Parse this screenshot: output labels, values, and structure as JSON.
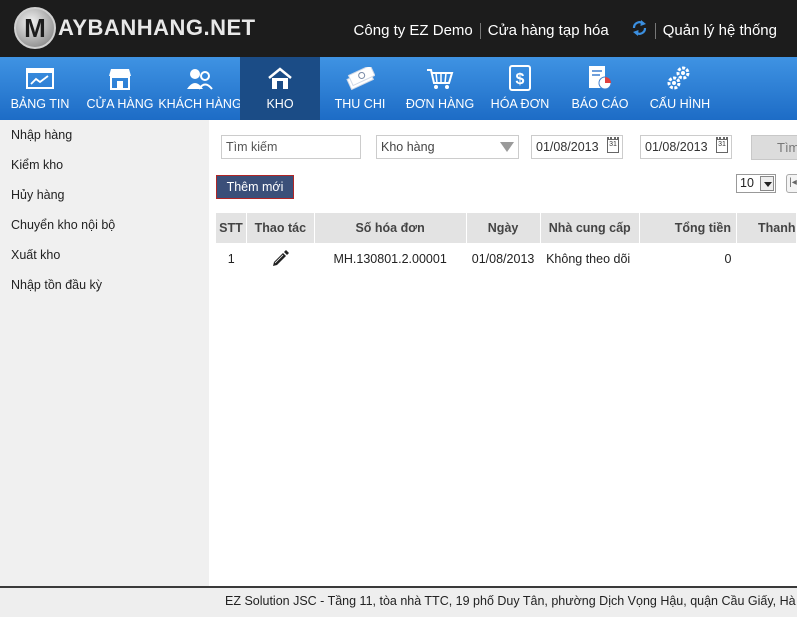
{
  "header": {
    "logo_letter": "M",
    "logo_text": "AYBANHANG.NET",
    "company": "Công ty EZ Demo",
    "store": "Cửa hàng tạp hóa",
    "admin": "Quản lý hệ thống"
  },
  "nav": {
    "items": [
      {
        "label": "BẢNG TIN",
        "icon": "dashboard-icon"
      },
      {
        "label": "CỬA HÀNG",
        "icon": "store-icon"
      },
      {
        "label": "KHÁCH HÀNG",
        "icon": "customers-icon"
      },
      {
        "label": "KHO",
        "icon": "warehouse-icon"
      },
      {
        "label": "THU CHI",
        "icon": "cash-icon"
      },
      {
        "label": "ĐƠN HÀNG",
        "icon": "cart-icon"
      },
      {
        "label": "HÓA ĐƠN",
        "icon": "invoice-icon"
      },
      {
        "label": "BÁO CÁO",
        "icon": "report-icon"
      },
      {
        "label": "CẤU HÌNH",
        "icon": "settings-icon"
      }
    ],
    "active_index": 3
  },
  "sidebar": {
    "items": [
      {
        "label": "Nhập hàng"
      },
      {
        "label": "Kiểm kho"
      },
      {
        "label": "Hủy hàng"
      },
      {
        "label": "Chuyển kho nội bộ"
      },
      {
        "label": "Xuất kho"
      },
      {
        "label": "Nhập tồn đầu kỳ"
      }
    ]
  },
  "filters": {
    "search_value": "Tìm kiếm",
    "warehouse_selected": "Kho hàng",
    "date_from": "01/08/2013",
    "date_to": "01/08/2013",
    "calendar_day": "31",
    "find_label": "Tìm"
  },
  "toolbar": {
    "add_label": "Thêm mới",
    "page_size": "10",
    "first_page": "|◂"
  },
  "table": {
    "headers": {
      "stt": "STT",
      "action": "Thao tác",
      "invoice": "Số hóa đơn",
      "date": "Ngày",
      "supplier": "Nhà cung cấp",
      "total": "Tổng tiền",
      "paid": "Thanh"
    },
    "rows": [
      {
        "stt": "1",
        "invoice": "MH.130801.2.00001",
        "date": "01/08/2013",
        "supplier": "Không theo dõi",
        "total": "0",
        "paid": ""
      }
    ]
  },
  "footer": {
    "text": "EZ Solution JSC - Tầng 11, tòa nhà TTC, 19 phố Duy Tân, phường Dịch Vọng Hậu, quận Cầu Giấy, Hà Nội"
  },
  "colors": {
    "topbar": "#1c1c1c",
    "nav_gradient_top": "#3f93e3",
    "nav_gradient_bottom": "#1d6cc6",
    "nav_active": "#1b4c86",
    "add_button": "#3b4f79"
  }
}
